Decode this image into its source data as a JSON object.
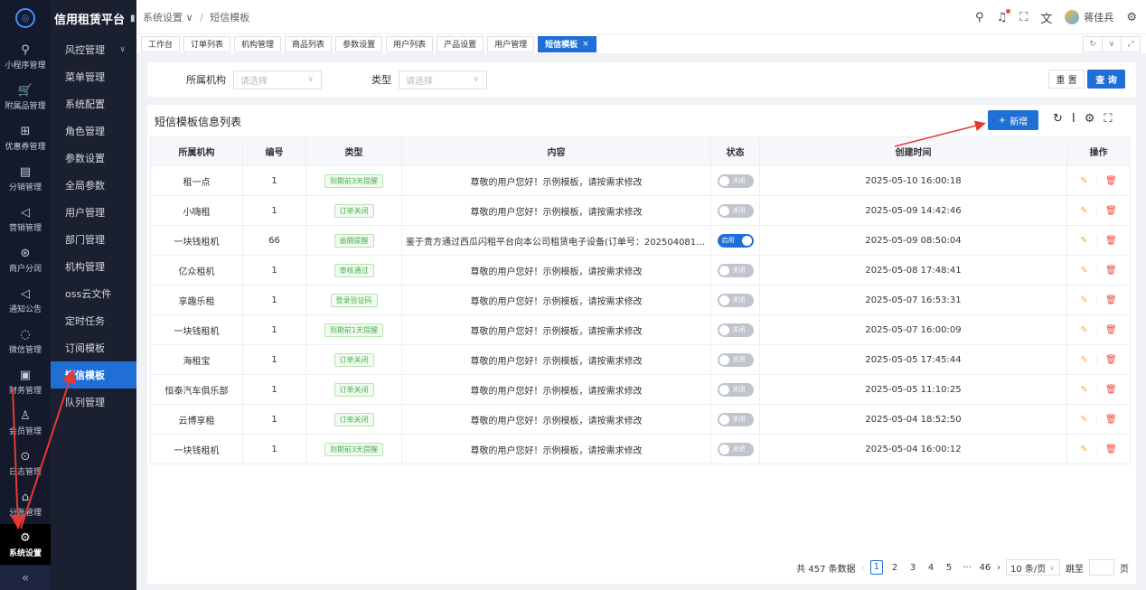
{
  "rail": {
    "items": [
      {
        "label": "小程序管理",
        "icon": "miniapp-icon",
        "glyph": "⚲"
      },
      {
        "label": "附属品管理",
        "icon": "cart-icon",
        "glyph": "🛒"
      },
      {
        "label": "优惠券管理",
        "icon": "gift-icon",
        "glyph": "⊞"
      },
      {
        "label": "分销管理",
        "icon": "chart-icon",
        "glyph": "▤"
      },
      {
        "label": "营销管理",
        "icon": "send-icon",
        "glyph": "◁"
      },
      {
        "label": "商户分润",
        "icon": "coin-icon",
        "glyph": "⊛"
      },
      {
        "label": "通知公告",
        "icon": "notice-icon",
        "glyph": "◁"
      },
      {
        "label": "微信管理",
        "icon": "wechat-icon",
        "glyph": "◌"
      },
      {
        "label": "财务管理",
        "icon": "finance-icon",
        "glyph": "▣"
      },
      {
        "label": "会员管理",
        "icon": "member-icon",
        "glyph": "♙"
      },
      {
        "label": "日志管理",
        "icon": "log-icon",
        "glyph": "⊙"
      },
      {
        "label": "分账管理",
        "icon": "split-icon",
        "glyph": "⌂"
      },
      {
        "label": "系统设置",
        "icon": "gear-icon",
        "glyph": "⚙"
      }
    ],
    "collapse": "«"
  },
  "submenu": {
    "brand": "信用租赁平台",
    "items": [
      "风控管理",
      "菜单管理",
      "系统配置",
      "角色管理",
      "参数设置",
      "全局参数",
      "用户管理",
      "部门管理",
      "机构管理",
      "oss云文件",
      "定时任务",
      "订阅模板",
      "短信模板",
      "队列管理"
    ]
  },
  "header": {
    "crumb1": "系统设置",
    "crumb2": "短信模板",
    "user": "蒋佳兵"
  },
  "tabs": [
    "工作台",
    "订单列表",
    "机构管理",
    "商品列表",
    "参数设置",
    "用户列表",
    "产品设置",
    "用户管理",
    "短信模板"
  ],
  "filter": {
    "org_label": "所属机构",
    "org_placeholder": "请选择",
    "type_label": "类型",
    "type_placeholder": "请选择",
    "reset": "重 置",
    "query": "查 询"
  },
  "list": {
    "title": "短信模板信息列表",
    "add": "新增",
    "columns": [
      "所属机构",
      "编号",
      "类型",
      "内容",
      "状态",
      "创建时间",
      "操作"
    ],
    "rows": [
      {
        "org": "租一点",
        "no": "1",
        "type": "到期前3天提醒",
        "content": "尊敬的用户您好！示例模板，请按需求修改",
        "status": "关闭",
        "on": false,
        "time": "2025-05-10 16:00:18"
      },
      {
        "org": "小嗨租",
        "no": "1",
        "type": "订单关闭",
        "content": "尊敬的用户您好！示例模板，请按需求修改",
        "status": "关闭",
        "on": false,
        "time": "2025-05-09 14:42:46"
      },
      {
        "org": "一块钱租机",
        "no": "66",
        "type": "逾期提醒",
        "content": "鉴于贵方通过西瓜闪租平台向本公司租赁电子设备(订单号：20250408164257...",
        "status": "启用",
        "on": true,
        "time": "2025-05-09 08:50:04"
      },
      {
        "org": "亿众租机",
        "no": "1",
        "type": "审核通过",
        "content": "尊敬的用户您好！示例模板，请按需求修改",
        "status": "关闭",
        "on": false,
        "time": "2025-05-08 17:48:41"
      },
      {
        "org": "享趣乐租",
        "no": "1",
        "type": "登录验证码",
        "content": "尊敬的用户您好！示例模板，请按需求修改",
        "status": "关闭",
        "on": false,
        "time": "2025-05-07 16:53:31"
      },
      {
        "org": "一块钱租机",
        "no": "1",
        "type": "到期前1天提醒",
        "content": "尊敬的用户您好！示例模板，请按需求修改",
        "status": "关闭",
        "on": false,
        "time": "2025-05-07 16:00:09"
      },
      {
        "org": "海租宝",
        "no": "1",
        "type": "订单关闭",
        "content": "尊敬的用户您好！示例模板，请按需求修改",
        "status": "关闭",
        "on": false,
        "time": "2025-05-05 17:45:44"
      },
      {
        "org": "恒泰汽车俱乐部",
        "no": "1",
        "type": "订单关闭",
        "content": "尊敬的用户您好！示例模板，请按需求修改",
        "status": "关闭",
        "on": false,
        "time": "2025-05-05 11:10:25"
      },
      {
        "org": "云博享租",
        "no": "1",
        "type": "订单关闭",
        "content": "尊敬的用户您好！示例模板，请按需求修改",
        "status": "关闭",
        "on": false,
        "time": "2025-05-04 18:52:50"
      },
      {
        "org": "一块钱租机",
        "no": "1",
        "type": "到期前3天提醒",
        "content": "尊敬的用户您好！示例模板，请按需求修改",
        "status": "关闭",
        "on": false,
        "time": "2025-05-04 16:00:12"
      }
    ]
  },
  "pager": {
    "total": "共 457 条数据",
    "pages": [
      "1",
      "2",
      "3",
      "4",
      "5",
      "···",
      "46"
    ],
    "size": "10 条/页",
    "jump": "跳至",
    "page_unit": "页"
  },
  "colors": {
    "primary": "#1f6fd6",
    "rail": "#14192b",
    "annotation": "#e53935"
  }
}
